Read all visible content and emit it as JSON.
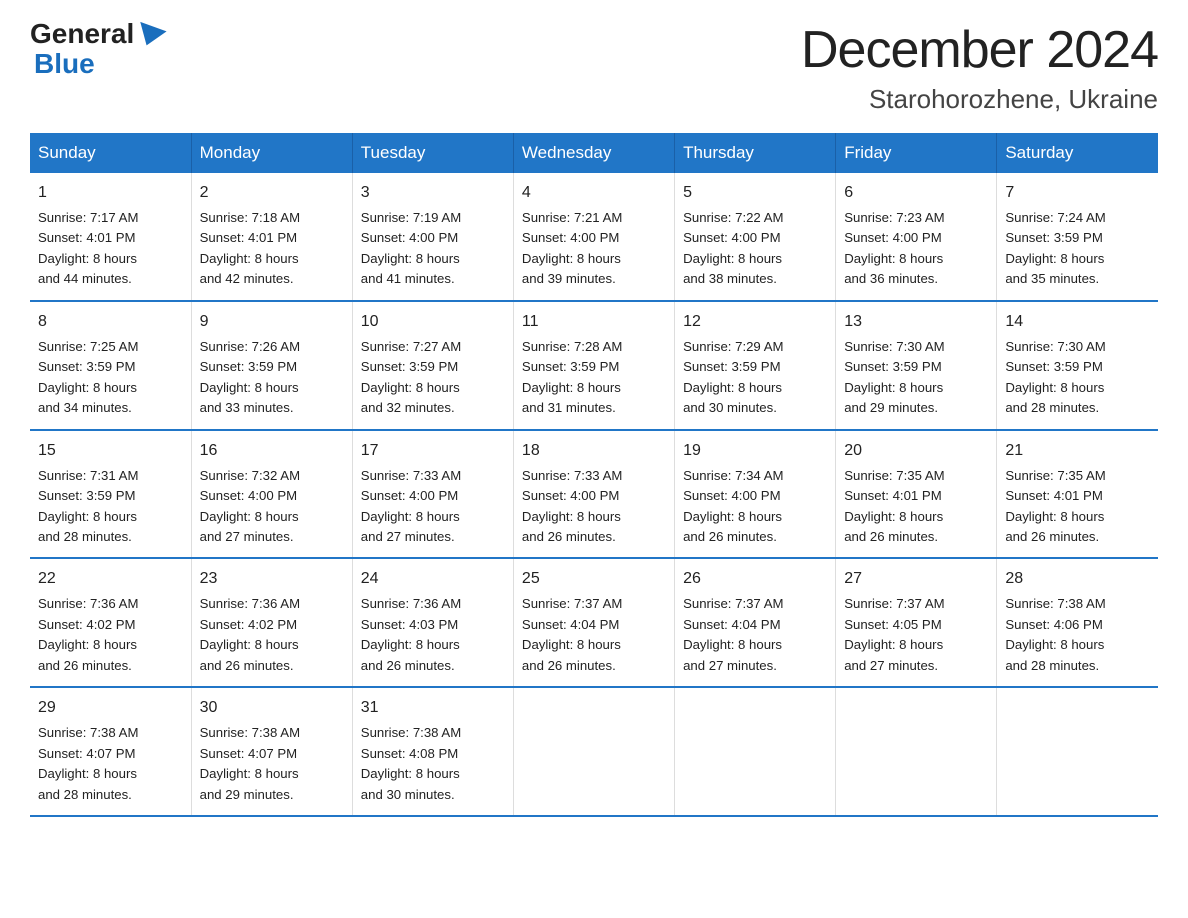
{
  "header": {
    "logo_general": "General",
    "logo_blue": "Blue",
    "title": "December 2024",
    "subtitle": "Starohorozhene, Ukraine"
  },
  "weekdays": [
    "Sunday",
    "Monday",
    "Tuesday",
    "Wednesday",
    "Thursday",
    "Friday",
    "Saturday"
  ],
  "weeks": [
    [
      {
        "day": "1",
        "info": "Sunrise: 7:17 AM\nSunset: 4:01 PM\nDaylight: 8 hours\nand 44 minutes."
      },
      {
        "day": "2",
        "info": "Sunrise: 7:18 AM\nSunset: 4:01 PM\nDaylight: 8 hours\nand 42 minutes."
      },
      {
        "day": "3",
        "info": "Sunrise: 7:19 AM\nSunset: 4:00 PM\nDaylight: 8 hours\nand 41 minutes."
      },
      {
        "day": "4",
        "info": "Sunrise: 7:21 AM\nSunset: 4:00 PM\nDaylight: 8 hours\nand 39 minutes."
      },
      {
        "day": "5",
        "info": "Sunrise: 7:22 AM\nSunset: 4:00 PM\nDaylight: 8 hours\nand 38 minutes."
      },
      {
        "day": "6",
        "info": "Sunrise: 7:23 AM\nSunset: 4:00 PM\nDaylight: 8 hours\nand 36 minutes."
      },
      {
        "day": "7",
        "info": "Sunrise: 7:24 AM\nSunset: 3:59 PM\nDaylight: 8 hours\nand 35 minutes."
      }
    ],
    [
      {
        "day": "8",
        "info": "Sunrise: 7:25 AM\nSunset: 3:59 PM\nDaylight: 8 hours\nand 34 minutes."
      },
      {
        "day": "9",
        "info": "Sunrise: 7:26 AM\nSunset: 3:59 PM\nDaylight: 8 hours\nand 33 minutes."
      },
      {
        "day": "10",
        "info": "Sunrise: 7:27 AM\nSunset: 3:59 PM\nDaylight: 8 hours\nand 32 minutes."
      },
      {
        "day": "11",
        "info": "Sunrise: 7:28 AM\nSunset: 3:59 PM\nDaylight: 8 hours\nand 31 minutes."
      },
      {
        "day": "12",
        "info": "Sunrise: 7:29 AM\nSunset: 3:59 PM\nDaylight: 8 hours\nand 30 minutes."
      },
      {
        "day": "13",
        "info": "Sunrise: 7:30 AM\nSunset: 3:59 PM\nDaylight: 8 hours\nand 29 minutes."
      },
      {
        "day": "14",
        "info": "Sunrise: 7:30 AM\nSunset: 3:59 PM\nDaylight: 8 hours\nand 28 minutes."
      }
    ],
    [
      {
        "day": "15",
        "info": "Sunrise: 7:31 AM\nSunset: 3:59 PM\nDaylight: 8 hours\nand 28 minutes."
      },
      {
        "day": "16",
        "info": "Sunrise: 7:32 AM\nSunset: 4:00 PM\nDaylight: 8 hours\nand 27 minutes."
      },
      {
        "day": "17",
        "info": "Sunrise: 7:33 AM\nSunset: 4:00 PM\nDaylight: 8 hours\nand 27 minutes."
      },
      {
        "day": "18",
        "info": "Sunrise: 7:33 AM\nSunset: 4:00 PM\nDaylight: 8 hours\nand 26 minutes."
      },
      {
        "day": "19",
        "info": "Sunrise: 7:34 AM\nSunset: 4:00 PM\nDaylight: 8 hours\nand 26 minutes."
      },
      {
        "day": "20",
        "info": "Sunrise: 7:35 AM\nSunset: 4:01 PM\nDaylight: 8 hours\nand 26 minutes."
      },
      {
        "day": "21",
        "info": "Sunrise: 7:35 AM\nSunset: 4:01 PM\nDaylight: 8 hours\nand 26 minutes."
      }
    ],
    [
      {
        "day": "22",
        "info": "Sunrise: 7:36 AM\nSunset: 4:02 PM\nDaylight: 8 hours\nand 26 minutes."
      },
      {
        "day": "23",
        "info": "Sunrise: 7:36 AM\nSunset: 4:02 PM\nDaylight: 8 hours\nand 26 minutes."
      },
      {
        "day": "24",
        "info": "Sunrise: 7:36 AM\nSunset: 4:03 PM\nDaylight: 8 hours\nand 26 minutes."
      },
      {
        "day": "25",
        "info": "Sunrise: 7:37 AM\nSunset: 4:04 PM\nDaylight: 8 hours\nand 26 minutes."
      },
      {
        "day": "26",
        "info": "Sunrise: 7:37 AM\nSunset: 4:04 PM\nDaylight: 8 hours\nand 27 minutes."
      },
      {
        "day": "27",
        "info": "Sunrise: 7:37 AM\nSunset: 4:05 PM\nDaylight: 8 hours\nand 27 minutes."
      },
      {
        "day": "28",
        "info": "Sunrise: 7:38 AM\nSunset: 4:06 PM\nDaylight: 8 hours\nand 28 minutes."
      }
    ],
    [
      {
        "day": "29",
        "info": "Sunrise: 7:38 AM\nSunset: 4:07 PM\nDaylight: 8 hours\nand 28 minutes."
      },
      {
        "day": "30",
        "info": "Sunrise: 7:38 AM\nSunset: 4:07 PM\nDaylight: 8 hours\nand 29 minutes."
      },
      {
        "day": "31",
        "info": "Sunrise: 7:38 AM\nSunset: 4:08 PM\nDaylight: 8 hours\nand 30 minutes."
      },
      {
        "day": "",
        "info": ""
      },
      {
        "day": "",
        "info": ""
      },
      {
        "day": "",
        "info": ""
      },
      {
        "day": "",
        "info": ""
      }
    ]
  ]
}
